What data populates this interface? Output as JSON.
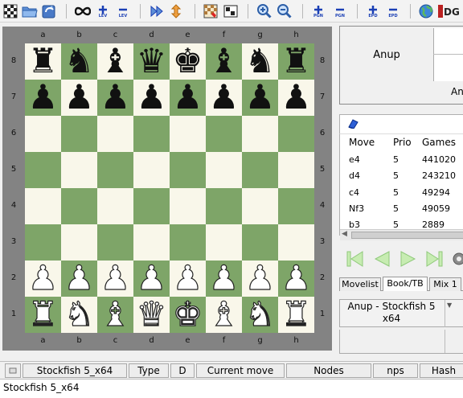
{
  "toolbar": {
    "sub_labels": {
      "lev_add": "LEV",
      "lev_remove": "LEV",
      "pgn_add": "PGN",
      "pgn_remove": "PGN",
      "epd_add": "EPD",
      "epd_remove": "EPD"
    },
    "dgt_label": "DGT"
  },
  "board": {
    "files": [
      "a",
      "b",
      "c",
      "d",
      "e",
      "f",
      "g",
      "h"
    ],
    "ranks": [
      "8",
      "7",
      "6",
      "5",
      "4",
      "3",
      "2",
      "1"
    ],
    "colors": {
      "light": "#f9f7ea",
      "dark": "#7ea568",
      "frame": "#838383"
    },
    "position": [
      [
        "bR",
        "bN",
        "bB",
        "bQ",
        "bK",
        "bB",
        "bN",
        "bR"
      ],
      [
        "bP",
        "bP",
        "bP",
        "bP",
        "bP",
        "bP",
        "bP",
        "bP"
      ],
      [
        "",
        "",
        "",
        "",
        "",
        "",
        "",
        ""
      ],
      [
        "",
        "",
        "",
        "",
        "",
        "",
        "",
        ""
      ],
      [
        "",
        "",
        "",
        "",
        "",
        "",
        "",
        ""
      ],
      [
        "",
        "",
        "",
        "",
        "",
        "",
        "",
        ""
      ],
      [
        "wP",
        "wP",
        "wP",
        "wP",
        "wP",
        "wP",
        "wP",
        "wP"
      ],
      [
        "wR",
        "wN",
        "wB",
        "wQ",
        "wK",
        "wB",
        "wN",
        "wR"
      ]
    ],
    "side_to_move": "white"
  },
  "players": {
    "white": "Anup",
    "black": "An"
  },
  "book": {
    "columns": [
      "Move",
      "Prio",
      "Games"
    ],
    "rows": [
      {
        "move": "e4",
        "prio": "5",
        "games": "441020"
      },
      {
        "move": "d4",
        "prio": "5",
        "games": "243210"
      },
      {
        "move": "c4",
        "prio": "5",
        "games": "49294"
      },
      {
        "move": "Nf3",
        "prio": "5",
        "games": "49059"
      },
      {
        "move": "b3",
        "prio": "5",
        "games": "2889"
      }
    ]
  },
  "tabs": [
    "Movelist",
    "Book/TB",
    "Mix 1"
  ],
  "active_tab": "Book/TB",
  "game_info": {
    "title_line1": "Anup - Stockfish 5",
    "title_line2": "x64"
  },
  "engine_bar": {
    "engine_name": "Stockfish 5_x64",
    "type_label": "Type",
    "d_label": "D",
    "current_move_label": "Current move",
    "nodes_label": "Nodes",
    "nps_label": "nps",
    "hash_label": "Hash"
  },
  "engine_output": "Stockfish 5_x64"
}
